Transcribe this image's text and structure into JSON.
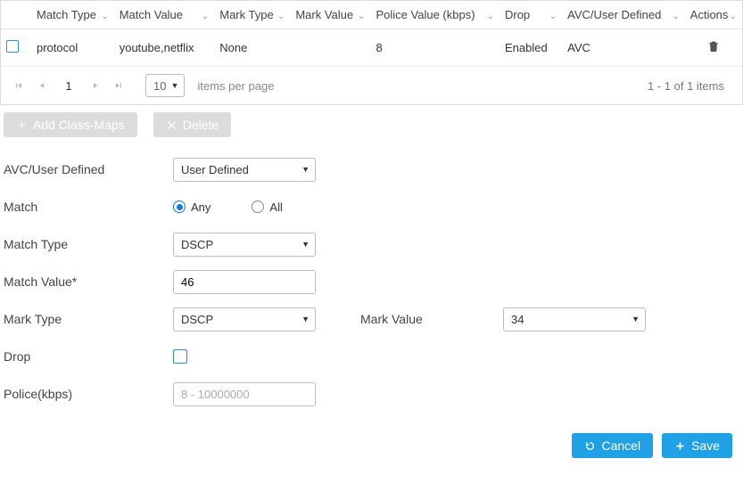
{
  "table": {
    "columns": [
      "Match Type",
      "Match Value",
      "Mark Type",
      "Mark Value",
      "Police Value (kbps)",
      "Drop",
      "AVC/User Defined",
      "Actions"
    ],
    "rows": [
      {
        "match_type": "protocol",
        "match_value": "youtube,netflix",
        "mark_type": "None",
        "mark_value": "",
        "police": "8",
        "drop": "Enabled",
        "avc": "AVC"
      }
    ],
    "page_current": "1",
    "page_size": "10",
    "per_page_label": "items per page",
    "items_info": "1 - 1 of 1 items"
  },
  "actions": {
    "add": "Add Class-Maps",
    "delete": "Delete"
  },
  "form": {
    "avc_label": "AVC/User Defined",
    "avc_value": "User Defined",
    "match_label": "Match",
    "match_any": "Any",
    "match_all": "All",
    "match_type_label": "Match Type",
    "match_type_value": "DSCP",
    "match_value_label": "Match Value*",
    "match_value_value": "46",
    "mark_type_label": "Mark Type",
    "mark_type_value": "DSCP",
    "mark_value_label": "Mark Value",
    "mark_value_value": "34",
    "drop_label": "Drop",
    "police_label": "Police(kbps)",
    "police_placeholder": "8 - 10000000"
  },
  "footer": {
    "cancel": "Cancel",
    "save": "Save"
  }
}
